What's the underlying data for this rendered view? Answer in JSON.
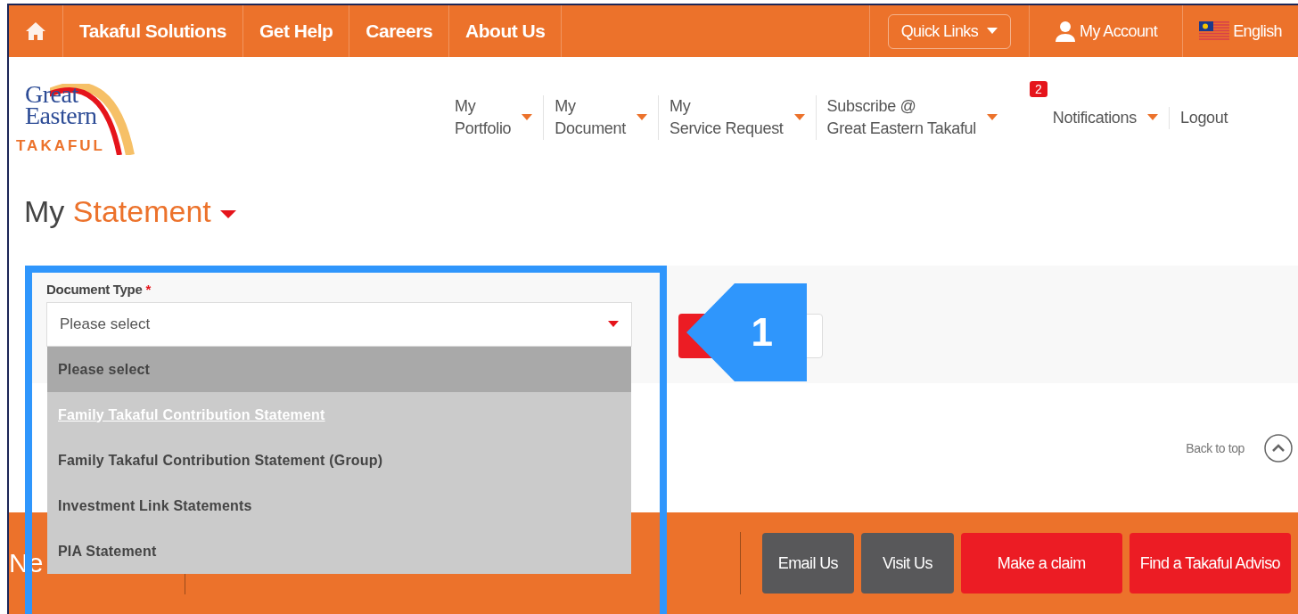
{
  "top_bar": {
    "items": [
      "Takaful Solutions",
      "Get Help",
      "Careers",
      "About Us"
    ],
    "quick_links": "Quick Links",
    "account": "My Account",
    "language": "English"
  },
  "logo": {
    "name": "Great\nEastern",
    "tagline": "TAKAFUL"
  },
  "main_nav": {
    "items": [
      {
        "label": "My\nPortfolio"
      },
      {
        "label": "My\nDocument"
      },
      {
        "label": "My\nService Request"
      },
      {
        "label": "Subscribe @\nGreat Eastern Takaful"
      }
    ],
    "notifications": {
      "badge": "2",
      "label": "Notifications"
    },
    "logout": "Logout"
  },
  "page_title": {
    "prefix": "My",
    "highlight": "Statement"
  },
  "form": {
    "document_type": {
      "label": "Document Type",
      "required_mark": "*",
      "value": "Please select",
      "options": [
        {
          "label": "Please select",
          "selected": true,
          "highlighted": false
        },
        {
          "label": "Family Takaful Contribution Statement",
          "selected": false,
          "highlighted": true
        },
        {
          "label": "Family Takaful Contribution Statement (Group)",
          "selected": false,
          "highlighted": false
        },
        {
          "label": "Investment Link Statements",
          "selected": false,
          "highlighted": false
        },
        {
          "label": "PIA Statement",
          "selected": false,
          "highlighted": false
        }
      ]
    }
  },
  "callout": {
    "number": "1"
  },
  "back_to_top": "Back to top",
  "footer": {
    "heading": "Ne",
    "buttons": [
      {
        "label": "Email Us",
        "kind": "grey"
      },
      {
        "label": "Visit Us",
        "kind": "grey"
      },
      {
        "label": "Make a claim",
        "kind": "red"
      },
      {
        "label": "Find a Takaful Adviso",
        "kind": "red"
      }
    ]
  }
}
